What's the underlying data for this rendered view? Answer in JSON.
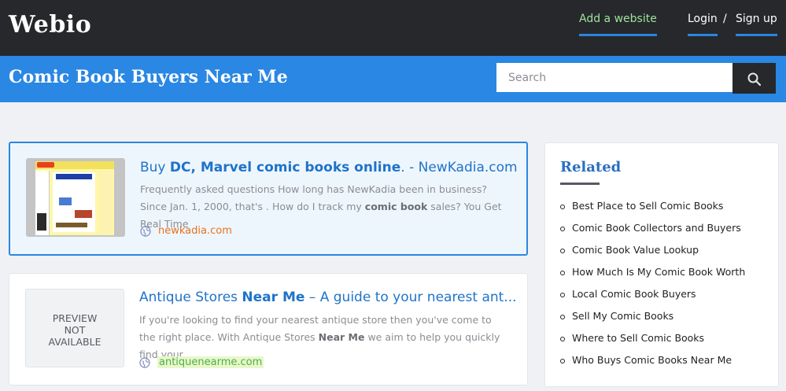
{
  "header": {
    "logo": "Webio",
    "add_website": "Add a website",
    "login": "Login",
    "separator": "/",
    "signup": "Sign up"
  },
  "titlebar": {
    "title": "Comic Book Buyers Near Me",
    "search_placeholder": "Search",
    "search_icon": "search-icon"
  },
  "results": [
    {
      "title_pre": "Buy ",
      "title_bold1": "DC",
      "title_mid": ", ",
      "title_bold2": "Marvel comic books online",
      "title_post": ". - NewKadia.com",
      "snippet_pre": "Frequently asked questions How long has NewKadia been in business? Since Jan. 1, 2000, that's . How do I track my ",
      "snippet_bold": "comic book",
      "snippet_post": " sales? You Get Real Time",
      "url": "newkadia.com"
    },
    {
      "title_pre": "Antique Stores ",
      "title_bold": "Near Me",
      "title_post": " – A guide to your nearest ant...",
      "snippet_pre": "If you're looking to find your nearest antique store then you've come to the right place. With Antique Stores ",
      "snippet_bold": "Near Me",
      "snippet_post": " we aim to help you quickly find your",
      "url": "antiquenearme.com",
      "preview_lines": [
        "PREVIEW",
        "NOT",
        "AVAILABLE"
      ]
    }
  ],
  "related": {
    "heading": "Related",
    "items": [
      "Best Place to Sell Comic Books",
      "Comic Book Collectors and Buyers",
      "Comic Book Value Lookup",
      "How Much Is My Comic Book Worth",
      "Local Comic Book Buyers",
      "Sell My Comic Books",
      "Where to Sell Comic Books",
      "Who Buys Comic Books Near Me"
    ]
  },
  "colors": {
    "topbar": "#26282c",
    "titlebar": "#2a87e3",
    "link": "#1f73c9",
    "url_orange": "#e8721c",
    "url_green": "#4caf50"
  }
}
